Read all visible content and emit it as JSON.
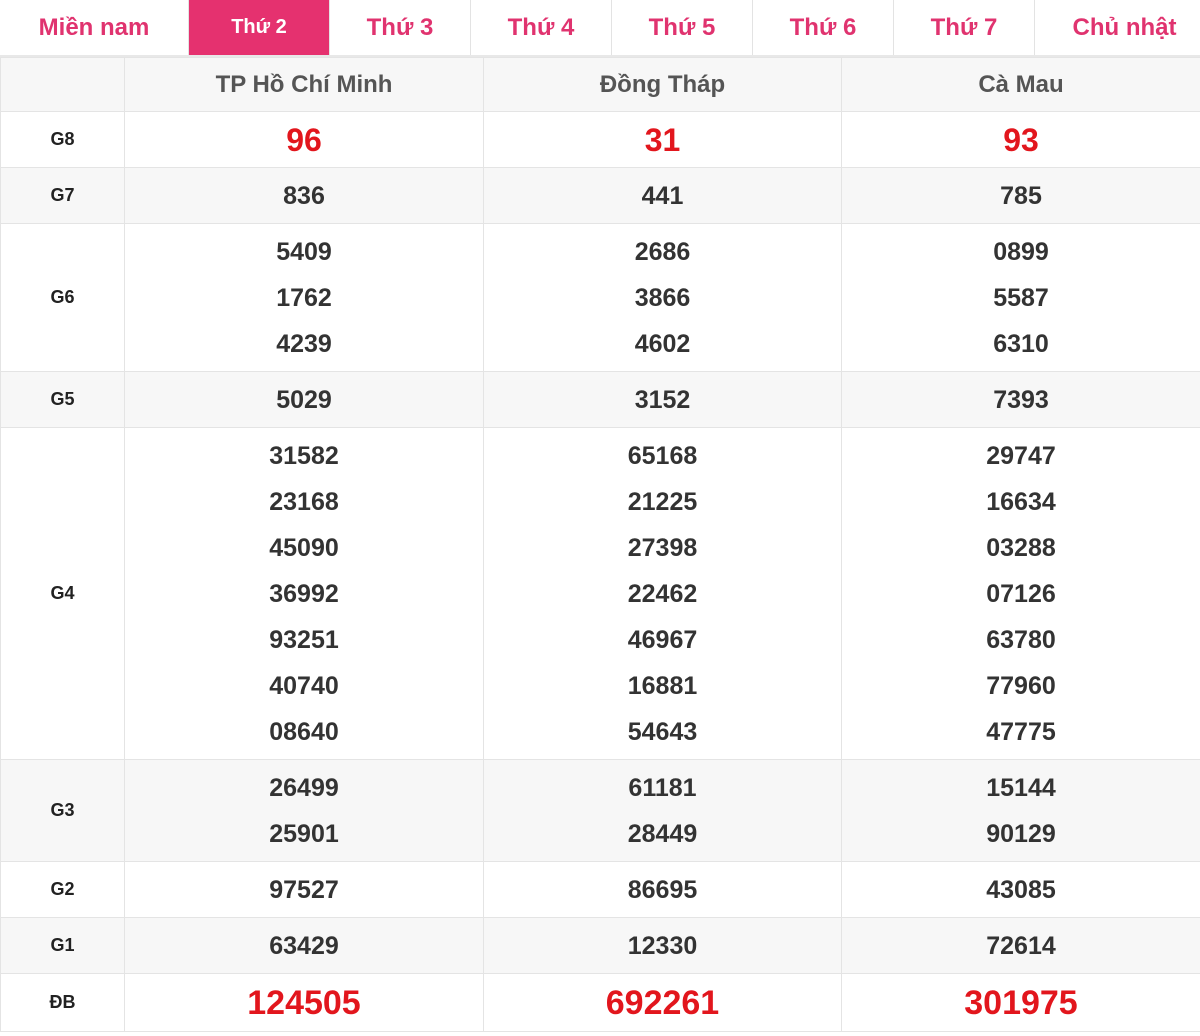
{
  "tabs": [
    {
      "label": "Miền nam",
      "kind": "region"
    },
    {
      "label": "Thứ 2",
      "kind": "day",
      "active": true
    },
    {
      "label": "Thứ 3",
      "kind": "day"
    },
    {
      "label": "Thứ 4",
      "kind": "day"
    },
    {
      "label": "Thứ 5",
      "kind": "day"
    },
    {
      "label": "Thứ 6",
      "kind": "day"
    },
    {
      "label": "Thứ 7",
      "kind": "day"
    },
    {
      "label": "Chủ nhật",
      "kind": "sun"
    }
  ],
  "provinces": [
    "TP Hồ Chí Minh",
    "Đồng Tháp",
    "Cà Mau"
  ],
  "colors": {
    "accent": "#e5316f",
    "red": "#e2161d",
    "text": "#333333"
  },
  "prizes": [
    {
      "label": "G8",
      "highlight": true,
      "cols": [
        [
          "96"
        ],
        [
          "31"
        ],
        [
          "93"
        ]
      ]
    },
    {
      "label": "G7",
      "cols": [
        [
          "836"
        ],
        [
          "441"
        ],
        [
          "785"
        ]
      ]
    },
    {
      "label": "G6",
      "cols": [
        [
          "5409",
          "1762",
          "4239"
        ],
        [
          "2686",
          "3866",
          "4602"
        ],
        [
          "0899",
          "5587",
          "6310"
        ]
      ]
    },
    {
      "label": "G5",
      "cols": [
        [
          "5029"
        ],
        [
          "3152"
        ],
        [
          "7393"
        ]
      ]
    },
    {
      "label": "G4",
      "cols": [
        [
          "31582",
          "23168",
          "45090",
          "36992",
          "93251",
          "40740",
          "08640"
        ],
        [
          "65168",
          "21225",
          "27398",
          "22462",
          "46967",
          "16881",
          "54643"
        ],
        [
          "29747",
          "16634",
          "03288",
          "07126",
          "63780",
          "77960",
          "47775"
        ]
      ]
    },
    {
      "label": "G3",
      "cols": [
        [
          "26499",
          "25901"
        ],
        [
          "61181",
          "28449"
        ],
        [
          "15144",
          "90129"
        ]
      ]
    },
    {
      "label": "G2",
      "cols": [
        [
          "97527"
        ],
        [
          "86695"
        ],
        [
          "43085"
        ]
      ]
    },
    {
      "label": "G1",
      "cols": [
        [
          "63429"
        ],
        [
          "12330"
        ],
        [
          "72614"
        ]
      ]
    },
    {
      "label": "ĐB",
      "special": true,
      "cols": [
        [
          "124505"
        ],
        [
          "692261"
        ],
        [
          "301975"
        ]
      ]
    }
  ]
}
